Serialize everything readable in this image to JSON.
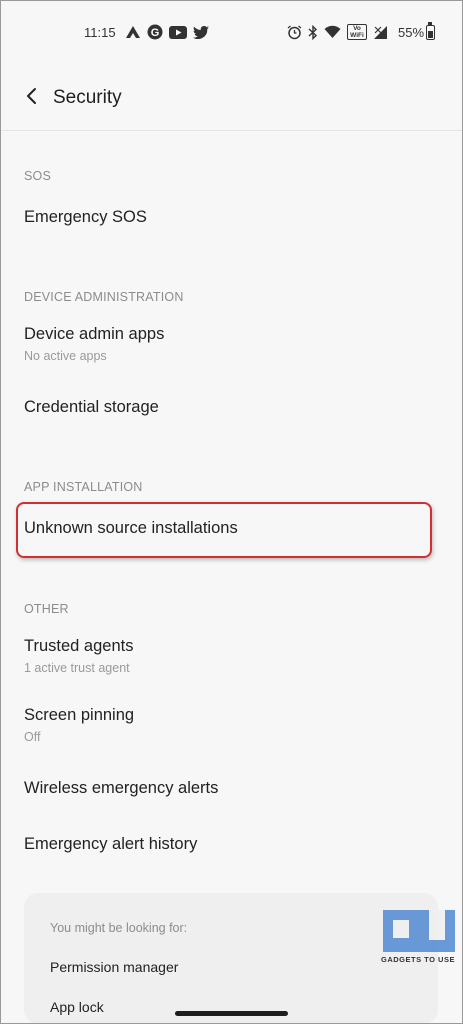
{
  "status_bar": {
    "time": "11:15",
    "battery_pct": "55%",
    "left_icons": [
      "notification-icon",
      "google-icon",
      "youtube-icon",
      "twitter-icon"
    ],
    "right_icons": [
      "alarm-icon",
      "bluetooth-icon",
      "wifi-icon",
      "vowifi-icon",
      "signal-icon"
    ],
    "vowifi_label": "Vo WiFi"
  },
  "header": {
    "title": "Security",
    "back_icon": "back-arrow-icon"
  },
  "sections": {
    "sos": {
      "label": "SOS",
      "items": [
        {
          "title": "Emergency SOS"
        }
      ]
    },
    "device_admin": {
      "label": "DEVICE ADMINISTRATION",
      "items": [
        {
          "title": "Device admin apps",
          "subtitle": "No active apps"
        },
        {
          "title": "Credential storage"
        }
      ]
    },
    "app_install": {
      "label": "APP INSTALLATION",
      "items": [
        {
          "title": "Unknown source installations"
        }
      ]
    },
    "other": {
      "label": "OTHER",
      "items": [
        {
          "title": "Trusted agents",
          "subtitle": "1 active trust agent"
        },
        {
          "title": "Screen pinning",
          "subtitle": "Off"
        },
        {
          "title": "Wireless emergency alerts"
        },
        {
          "title": "Emergency alert history"
        }
      ]
    }
  },
  "suggestions": {
    "header": "You might be looking for:",
    "items": [
      "Permission manager",
      "App lock"
    ]
  },
  "watermark": {
    "text": "GADGETS TO USE"
  },
  "colors": {
    "highlight": "#d0302f",
    "background": "#f7f7f7",
    "logo": "#5b8fd4"
  }
}
